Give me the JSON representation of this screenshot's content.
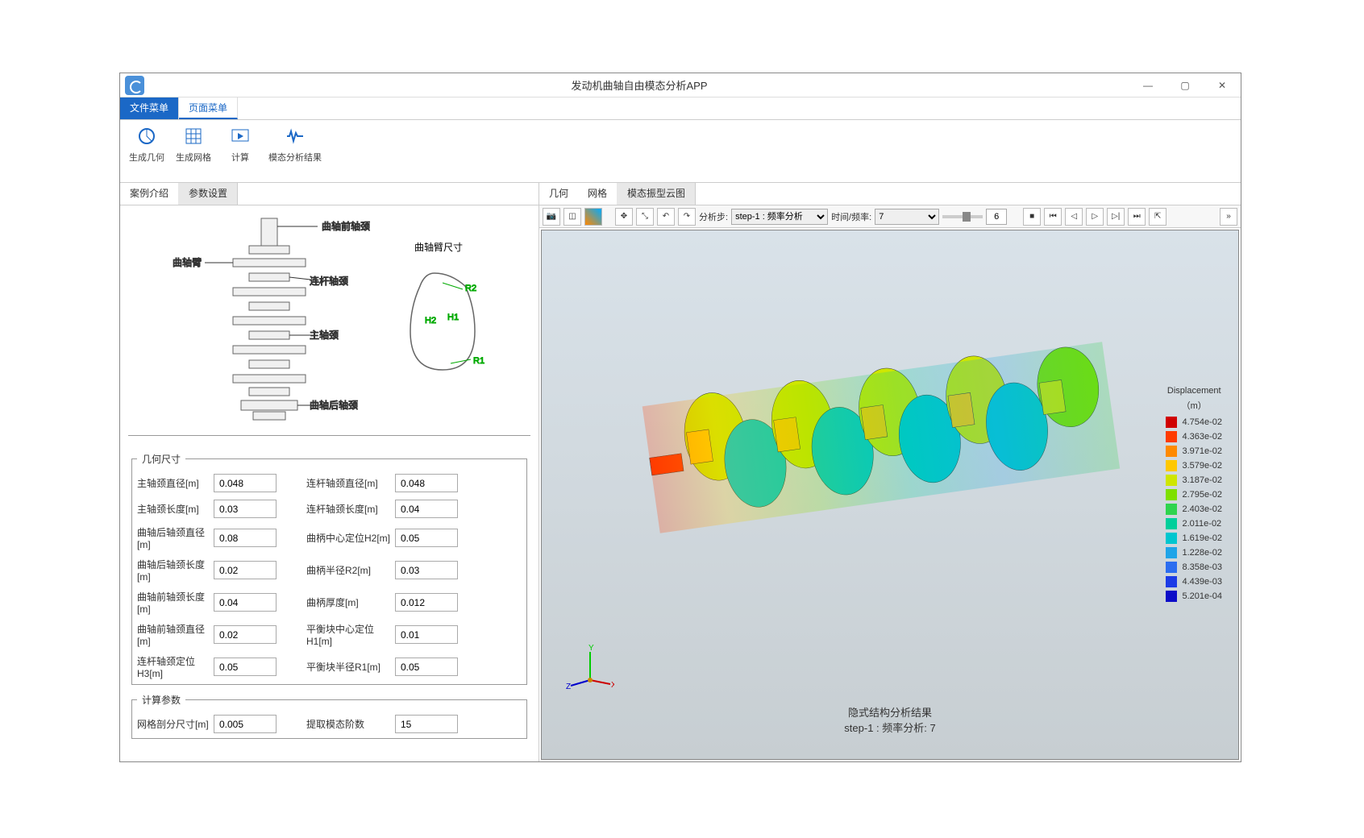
{
  "window": {
    "title": "发动机曲轴自由模态分析APP"
  },
  "menus": {
    "file": "文件菜单",
    "page": "页面菜单"
  },
  "ribbon": {
    "gen_geom": "生成几何",
    "gen_mesh": "生成网格",
    "compute": "计算",
    "modal_result": "模态分析结果"
  },
  "left_tabs": {
    "intro": "案例介绍",
    "params": "参数设置"
  },
  "diagram_labels": {
    "front_journal": "曲轴前轴颈",
    "crank_arm": "曲轴臂",
    "conrod_journal": "连杆轴颈",
    "main_journal": "主轴颈",
    "rear_journal": "曲轴后轴颈",
    "arm_dim": "曲轴臂尺寸",
    "r2": "R2",
    "r1": "R1",
    "h1": "H1",
    "h2": "H2"
  },
  "geom_section": {
    "legend": "几何尺寸",
    "rows": [
      {
        "l1": "主轴颈直径[m]",
        "v1": "0.048",
        "l2": "连杆轴颈直径[m]",
        "v2": "0.048"
      },
      {
        "l1": "主轴颈长度[m]",
        "v1": "0.03",
        "l2": "连杆轴颈长度[m]",
        "v2": "0.04"
      },
      {
        "l1": "曲轴后轴颈直径[m]",
        "v1": "0.08",
        "l2": "曲柄中心定位H2[m]",
        "v2": "0.05"
      },
      {
        "l1": "曲轴后轴颈长度[m]",
        "v1": "0.02",
        "l2": "曲柄半径R2[m]",
        "v2": "0.03"
      },
      {
        "l1": "曲轴前轴颈长度[m]",
        "v1": "0.04",
        "l2": "曲柄厚度[m]",
        "v2": "0.012"
      },
      {
        "l1": "曲轴前轴颈直径[m]",
        "v1": "0.02",
        "l2": "平衡块中心定位H1[m]",
        "v2": "0.01"
      },
      {
        "l1": "连杆轴颈定位H3[m]",
        "v1": "0.05",
        "l2": "平衡块半径R1[m]",
        "v2": "0.05"
      }
    ]
  },
  "calc_section": {
    "legend": "计算参数",
    "mesh_label": "网格剖分尺寸[m]",
    "mesh_val": "0.005",
    "modes_label": "提取模态阶数",
    "modes_val": "15"
  },
  "right_tabs": {
    "geom": "几何",
    "mesh": "网格",
    "contour": "模态振型云图"
  },
  "view_toolbar": {
    "step_label": "分析步:",
    "step_value": "step-1 : 频率分析",
    "time_label": "时间/频率:",
    "time_value": "7",
    "frame": "6"
  },
  "result_caption": {
    "line1": "隐式结构分析结果",
    "line2": "step-1 : 频率分析: 7"
  },
  "legend_scale": {
    "title": "Displacement",
    "unit": "（m）",
    "items": [
      {
        "c": "#d00000",
        "v": "4.754e-02"
      },
      {
        "c": "#ff3b00",
        "v": "4.363e-02"
      },
      {
        "c": "#ff8a00",
        "v": "3.971e-02"
      },
      {
        "c": "#ffc800",
        "v": "3.579e-02"
      },
      {
        "c": "#cfe600",
        "v": "3.187e-02"
      },
      {
        "c": "#7ee000",
        "v": "2.795e-02"
      },
      {
        "c": "#2fd44d",
        "v": "2.403e-02"
      },
      {
        "c": "#00cf9b",
        "v": "2.011e-02"
      },
      {
        "c": "#00c6cf",
        "v": "1.619e-02"
      },
      {
        "c": "#1fa4e8",
        "v": "1.228e-02"
      },
      {
        "c": "#2b6df0",
        "v": "8.358e-03"
      },
      {
        "c": "#1c3be6",
        "v": "4.439e-03"
      },
      {
        "c": "#0c0cc8",
        "v": "5.201e-04"
      }
    ]
  }
}
